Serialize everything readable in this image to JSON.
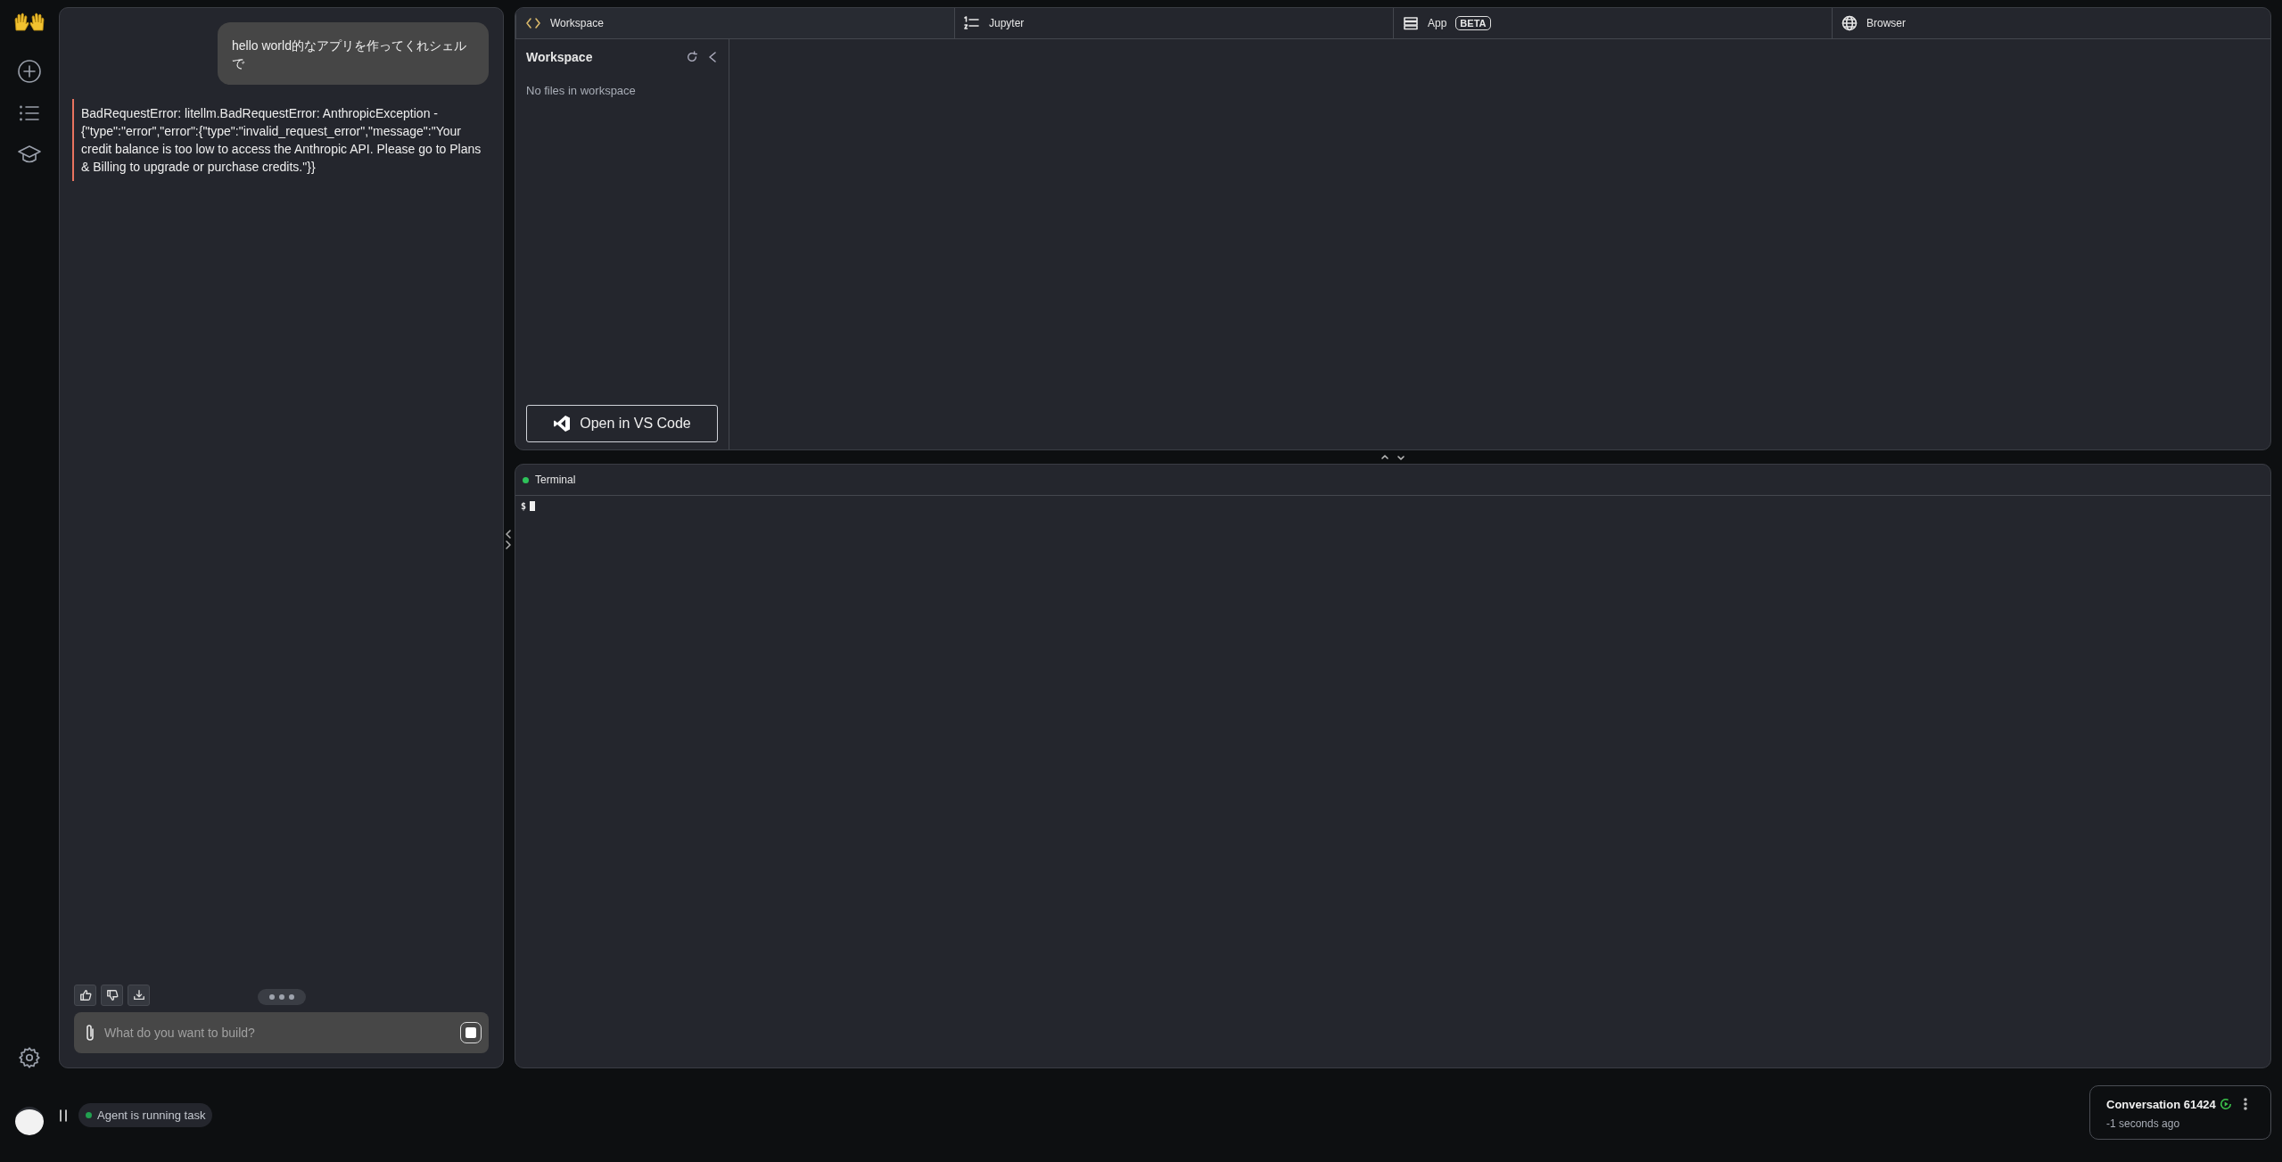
{
  "chat": {
    "messages": [
      {
        "kind": "user",
        "text": "hello world的なアプリを作ってくれシェルで"
      },
      {
        "kind": "error",
        "text": "BadRequestError: litellm.BadRequestError: AnthropicException - {\"type\":\"error\",\"error\":{\"type\":\"invalid_request_error\",\"message\":\"Your credit balance is too low to access the Anthropic API. Please go to Plans & Billing to upgrade or purchase credits.\"}}"
      }
    ],
    "input": {
      "placeholder": "What do you want to build?"
    }
  },
  "tabs": [
    {
      "kind": "code",
      "label": "Workspace",
      "selected": true
    },
    {
      "kind": "jupyter",
      "label": "Jupyter",
      "selected": false
    },
    {
      "kind": "app",
      "label": "App",
      "badge": "BETA",
      "selected": false
    },
    {
      "kind": "browser",
      "label": "Browser",
      "selected": false
    }
  ],
  "workspace": {
    "title": "Workspace",
    "empty_text": "No files in workspace",
    "button": "Open in VS Code"
  },
  "terminal": {
    "title": "Terminal",
    "prompt": "$"
  },
  "status": {
    "text": "Agent is running task",
    "color": "#22a050"
  },
  "conversation": {
    "title": "Conversation 61424",
    "time": "-1 seconds ago"
  }
}
